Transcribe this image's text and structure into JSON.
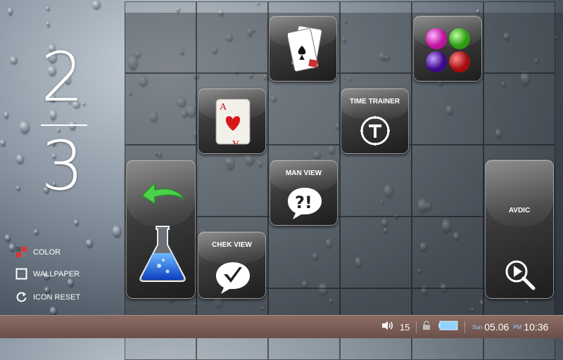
{
  "pager": {
    "current": "2",
    "total": "3"
  },
  "options": {
    "color_label": "COLOR",
    "wallpaper_label": "WALLPAPER",
    "reset_label": "ICON RESET"
  },
  "tiles": {
    "time_trainer": "TIME TRAINER",
    "man_view": "MAN VIEW",
    "chek_view": "CHEK VIEW",
    "avdic": "AVDIC"
  },
  "taskbar": {
    "volume": "15",
    "day": "Sun",
    "date": "05.06",
    "ampm": "PM",
    "time": "10:36"
  },
  "colors": {
    "taskbar": "#7a5d56",
    "battery": "#8fd3ff"
  }
}
